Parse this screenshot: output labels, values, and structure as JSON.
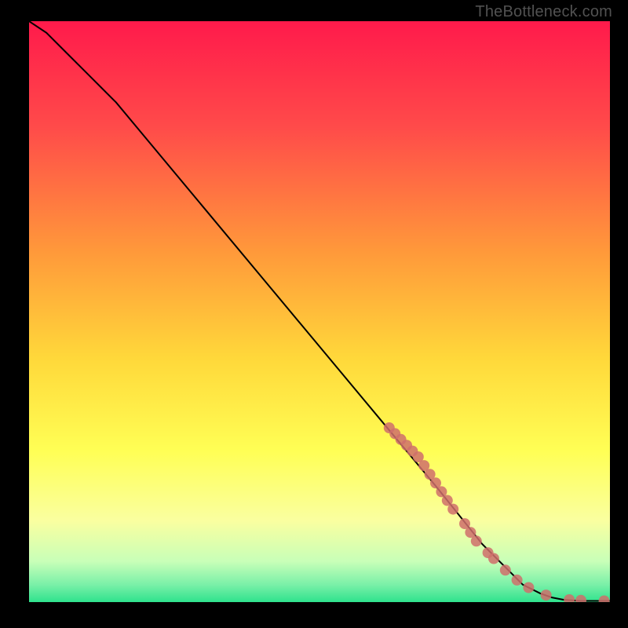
{
  "watermark": "TheBottleneck.com",
  "colors": {
    "bg": "#000000",
    "curve": "#000000",
    "marker_fill": "#cf6f6b",
    "marker_stroke": "#cf6f6b",
    "grad_top": "#ff1a4b",
    "grad_mid1": "#ff7a3a",
    "grad_mid2": "#ffd83a",
    "grad_mid3": "#ffff66",
    "grad_mid4": "#e9ffb0",
    "grad_bottom": "#2fe28d"
  },
  "chart_data": {
    "type": "line",
    "title": "",
    "xlabel": "",
    "ylabel": "",
    "xlim": [
      0,
      100
    ],
    "ylim": [
      0,
      100
    ],
    "series": [
      {
        "name": "curve",
        "x": [
          0,
          3,
          6,
          10,
          15,
          20,
          30,
          40,
          50,
          60,
          70,
          78,
          82,
          85,
          88,
          90,
          92,
          95,
          100
        ],
        "y": [
          100,
          98,
          95,
          91,
          86,
          80,
          68,
          56,
          44,
          32,
          20,
          10,
          6,
          3,
          1.5,
          0.8,
          0.4,
          0.2,
          0.2
        ]
      }
    ],
    "markers": {
      "name": "highlight-points",
      "x": [
        62,
        63,
        64,
        65,
        66,
        67,
        68,
        69,
        70,
        71,
        72,
        73,
        75,
        76,
        77,
        79,
        80,
        82,
        84,
        86,
        89,
        93,
        95,
        99
      ],
      "y": [
        30,
        29,
        28,
        27,
        26,
        25,
        23.5,
        22,
        20.5,
        19,
        17.5,
        16,
        13.5,
        12,
        10.5,
        8.5,
        7.5,
        5.5,
        3.8,
        2.5,
        1.2,
        0.4,
        0.3,
        0.2
      ]
    }
  }
}
